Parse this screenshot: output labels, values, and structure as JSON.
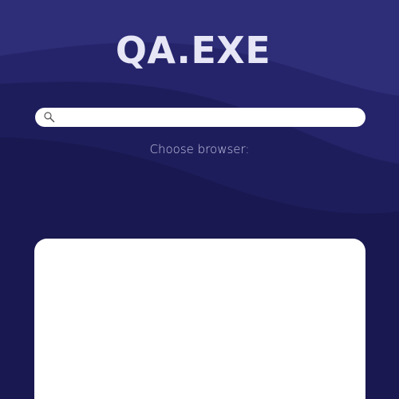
{
  "app": {
    "title": "QA.EXE"
  },
  "search": {
    "value": "",
    "placeholder": ""
  },
  "browser_select": {
    "prompt": "Choose browser:"
  },
  "colors": {
    "background": "#191850",
    "accent": "#2F2E78",
    "logo_text": "#E6E6F6",
    "subtitle_text": "#C8C8E6"
  },
  "icons": {
    "search": "magnifier-icon"
  }
}
